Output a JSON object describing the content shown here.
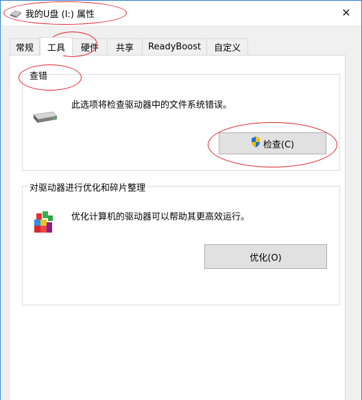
{
  "window": {
    "title": "我的U盘 (I:) 属性",
    "close_label": "✕"
  },
  "tabs": [
    {
      "label": "常规",
      "active": false
    },
    {
      "label": "工具",
      "active": true
    },
    {
      "label": "硬件",
      "active": false
    },
    {
      "label": "共享",
      "active": false
    },
    {
      "label": "ReadyBoost",
      "active": false
    },
    {
      "label": "自定义",
      "active": false
    }
  ],
  "error_check": {
    "group_title": "查错",
    "description": "此选项将检查驱动器中的文件系统错误。",
    "button_label": "检查(C)",
    "icon": "drive-icon",
    "button_icon": "uac-shield-icon"
  },
  "optimize": {
    "group_title": "对驱动器进行优化和碎片整理",
    "description": "优化计算机的驱动器可以帮助其更高效运行。",
    "button_label": "优化(O)",
    "icon": "defrag-icon"
  },
  "colors": {
    "annotation": "#e0202a",
    "window_border": "#2b7bd0",
    "button_bg": "#e1e1e1"
  }
}
